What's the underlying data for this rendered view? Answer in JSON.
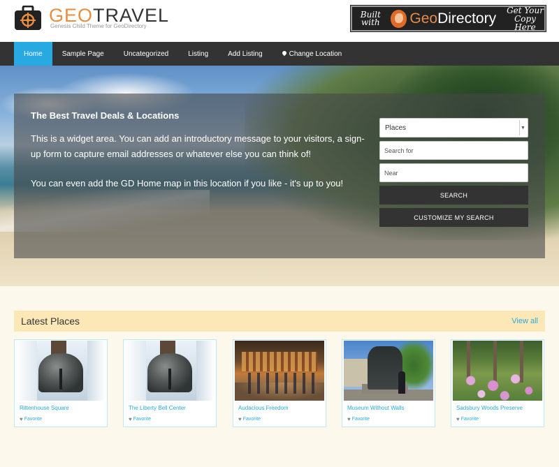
{
  "site": {
    "logo_geo": "GEO",
    "logo_travel": "TRAVEL",
    "logo_subtitle": "Genesis Child Theme for GeoDirectory",
    "logo_icon": "suitcase-target-icon"
  },
  "banner": {
    "built_with": "Built with",
    "brand_geo": "Geo",
    "brand_directory": "Directory",
    "get_copy": "Get Your Copy Here",
    "icon": "globe-icon"
  },
  "nav": {
    "items": [
      {
        "label": "Home",
        "active": true
      },
      {
        "label": "Sample Page"
      },
      {
        "label": "Uncategorized"
      },
      {
        "label": "Listing"
      },
      {
        "label": "Add Listing"
      },
      {
        "label": "Change Location",
        "icon": "map-marker-icon"
      }
    ]
  },
  "hero": {
    "title": "The Best Travel Deals & Locations",
    "paragraph1": "This is a widget area. You can add an introductory message to your visitors, a sign-up form to capture email addresses or whatever else you can think of!",
    "paragraph2": "You can even add the GD Home map in this location if you like - it's up to you!",
    "search": {
      "post_type_selected": "Places",
      "search_placeholder": "Search for",
      "near_placeholder": "Near",
      "search_button": "SEARCH",
      "customize_button": "CUSTOMIZE MY SEARCH"
    }
  },
  "latest": {
    "title": "Latest Places",
    "view_all": "View all",
    "places": [
      {
        "name": "Rittenhouse Square",
        "favorite": "Favorite"
      },
      {
        "name": "The Liberty Bell Center",
        "favorite": "Favorite"
      },
      {
        "name": "Audacious Freedom",
        "favorite": "Favorite"
      },
      {
        "name": "Museum Without Walls",
        "favorite": "Favorite"
      },
      {
        "name": "Sadsbury Woods Preserve",
        "favorite": "Favorite"
      }
    ]
  },
  "colors": {
    "accent": "#29a9e1",
    "nav_bg": "#333333",
    "logo_orange": "#e98d3f",
    "section_bg": "#fdf8ec",
    "latest_bar": "#fbe8b6"
  }
}
